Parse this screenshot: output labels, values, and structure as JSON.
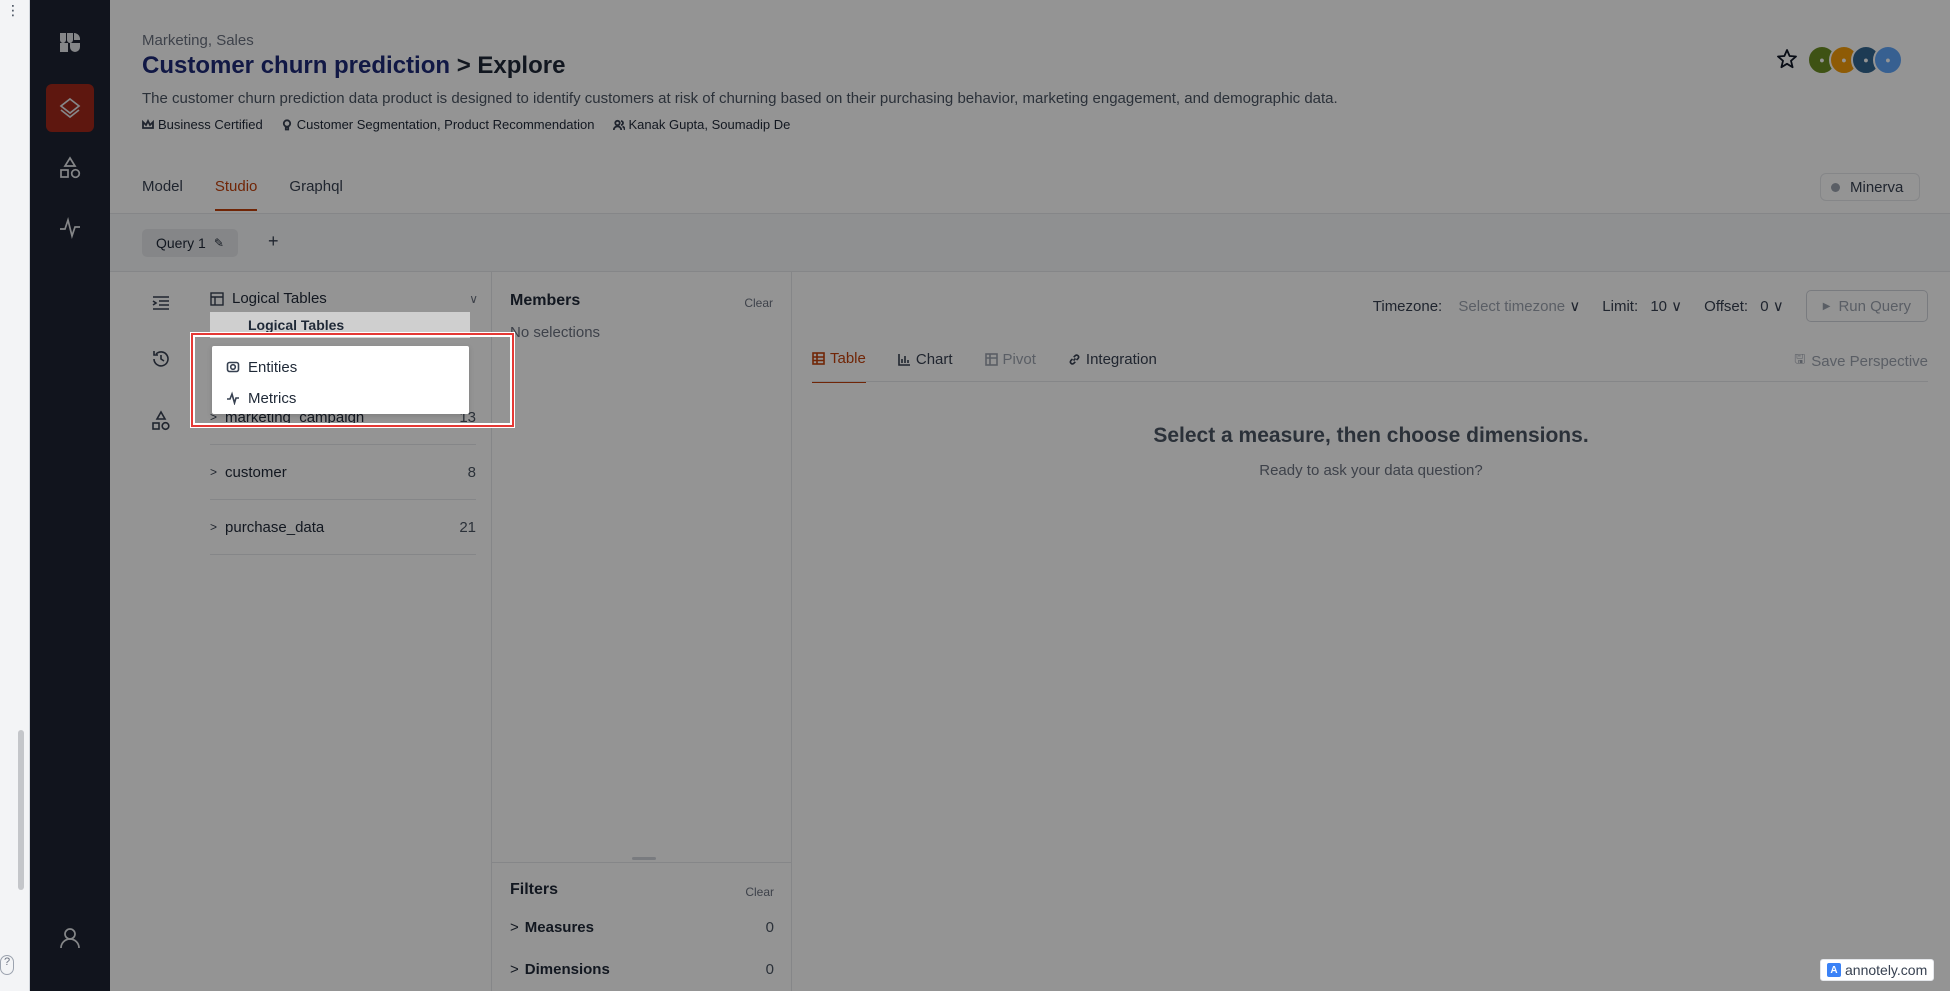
{
  "header": {
    "breadcrumb": "Marketing, Sales",
    "title": "Customer churn prediction",
    "subtitle": "> Explore",
    "description": "The customer churn prediction data product is designed to identify customers at risk of churning based on their purchasing behavior, marketing engagement, and demographic data.",
    "certification": "Business Certified",
    "use_cases": "Customer Segmentation, Product Recommendation",
    "owners": "Kanak Gupta, Soumadip De"
  },
  "tabs": [
    "Model",
    "Studio",
    "Graphql"
  ],
  "active_tab": "Studio",
  "cluster": "Minerva",
  "query_tab": "Query 1",
  "tables_panel": {
    "selector_label": "Logical Tables",
    "dropdown_peek": "Logical Tables",
    "rows": [
      {
        "name": "marketing_campaign",
        "count": "13"
      },
      {
        "name": "customer",
        "count": "8"
      },
      {
        "name": "purchase_data",
        "count": "21"
      }
    ]
  },
  "dropdown": {
    "items": [
      "Entities",
      "Metrics"
    ]
  },
  "members": {
    "heading": "Members",
    "clear": "Clear",
    "empty": "No selections"
  },
  "filters": {
    "heading": "Filters",
    "clear": "Clear",
    "rows": [
      {
        "label": "Measures",
        "count": "0"
      },
      {
        "label": "Dimensions",
        "count": "0"
      }
    ]
  },
  "results": {
    "timezone_label": "Timezone:",
    "timezone_placeholder": "Select timezone",
    "limit_label": "Limit:",
    "limit_value": "10",
    "offset_label": "Offset:",
    "offset_value": "0",
    "run_label": "Run Query",
    "tabs": [
      "Table",
      "Chart",
      "Pivot",
      "Integration"
    ],
    "save_label": "Save Perspective",
    "empty_heading": "Select a measure, then choose dimensions.",
    "empty_sub": "Ready to ask your data question?"
  },
  "watermark": "annotely.com",
  "colors": {
    "accent": "#c2410c",
    "rail": "#1e2433",
    "rail_active": "#a3281a",
    "title": "#1e2a78",
    "highlight": "#e53935"
  }
}
